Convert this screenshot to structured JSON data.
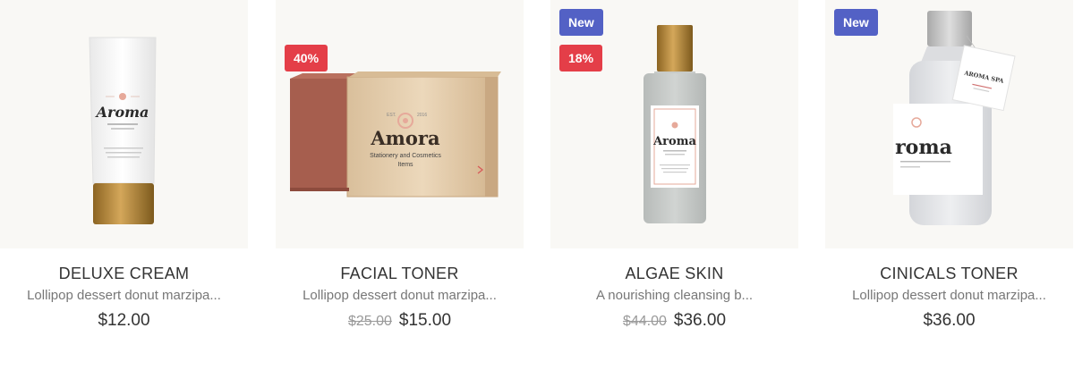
{
  "products": [
    {
      "title": "DELUXE CREAM",
      "desc": "Lollipop dessert donut marzipa...",
      "price": "$12.00",
      "old_price": "",
      "badges": [],
      "brand_text": "Aroma",
      "colors": {
        "cap": "#b8893a",
        "body": "#fdfdfd"
      }
    },
    {
      "title": "FACIAL TONER",
      "desc": "Lollipop dessert donut marzipa...",
      "price": "$15.00",
      "old_price": "$25.00",
      "badges": [
        "40%"
      ],
      "brand_text": "Amora",
      "brand_sub": "Stationery and Cosmetics",
      "brand_sub2": "Items",
      "colors": {
        "box": "#e8d3b5",
        "soap": "#a65e4e"
      }
    },
    {
      "title": "ALGAE SKIN",
      "desc": "A nourishing cleansing b...",
      "price": "$36.00",
      "old_price": "$44.00",
      "badges": [
        "New",
        "18%"
      ],
      "brand_text": "Aroma",
      "colors": {
        "cap": "#b8893a",
        "body": "#c4c8c6"
      }
    },
    {
      "title": "CINICALS TONER",
      "desc": "Lollipop dessert donut marzipa...",
      "price": "$36.00",
      "old_price": "",
      "badges": [
        "New"
      ],
      "brand_text": "roma",
      "tag_text": "AROMA SPA",
      "colors": {
        "cap": "#c6c6c6",
        "body": "#e6e7ea"
      }
    }
  ],
  "colors": {
    "new_badge": "#5361c5",
    "sale_badge": "#e43e48",
    "image_bg": "#f9f8f5"
  }
}
